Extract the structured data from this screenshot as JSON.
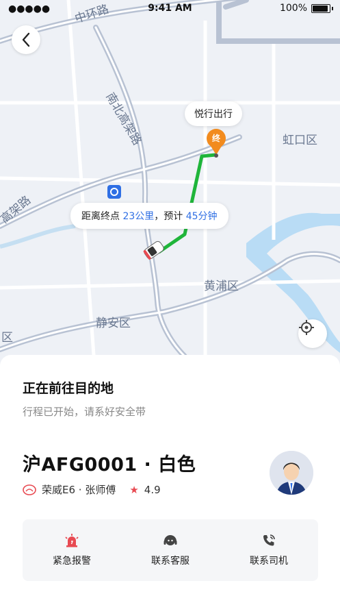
{
  "status_bar": {
    "time": "9:41 AM",
    "battery": "100%",
    "signal_dots": "●●●●●"
  },
  "map": {
    "labels": {
      "zhonghuan": "中环路",
      "nanbei": "南北高架路",
      "gaojia": "高架路",
      "hongkou": "虹口区",
      "huangpu": "黄浦区",
      "jingan": "静安区",
      "partial_qu": "区"
    },
    "brand_bubble": "悦行出行",
    "end_marker": "终",
    "distance": {
      "prefix": "距离终点 ",
      "km": "23公里",
      "mid": "，预计 ",
      "time": "45分钟"
    }
  },
  "colors": {
    "route": "#1fb53a",
    "accent_blue": "#2f6fe4",
    "marker_orange": "#f28b1e",
    "alert_red": "#e84a52"
  },
  "trip": {
    "title": "正在前往目的地",
    "subtitle": "行程已开始，请系好安全带",
    "plate": "沪AFG0001 · 白色",
    "car_model": "荣威E6 · 张师傅",
    "rating": "4.9"
  },
  "actions": [
    {
      "label": "紧急报警",
      "icon": "alarm-siren-icon"
    },
    {
      "label": "联系客服",
      "icon": "customer-service-icon"
    },
    {
      "label": "联系司机",
      "icon": "phone-icon"
    }
  ]
}
